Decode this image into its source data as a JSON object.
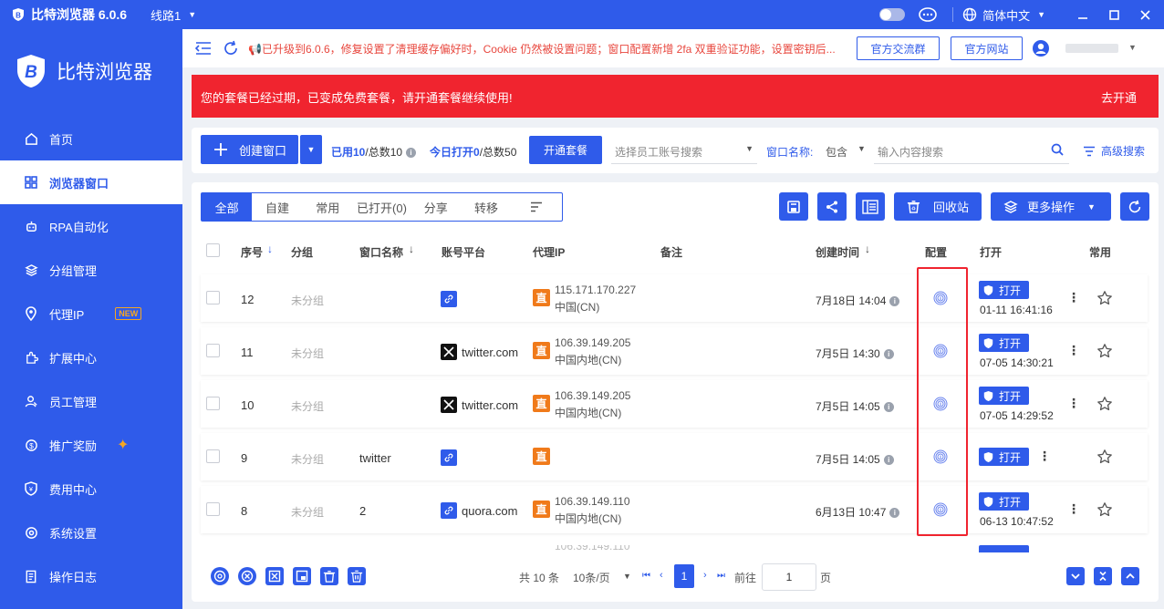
{
  "titlebar": {
    "app_title": "比特浏览器 6.0.6",
    "line": "线路1",
    "language": "简体中文"
  },
  "sidebar": {
    "brand": "比特浏览器",
    "items": [
      {
        "label": "首页",
        "icon": "home-icon"
      },
      {
        "label": "浏览器窗口",
        "icon": "grid-icon",
        "active": true
      },
      {
        "label": "RPA自动化",
        "icon": "rpa-icon"
      },
      {
        "label": "分组管理",
        "icon": "layers-icon"
      },
      {
        "label": "代理IP",
        "icon": "location-icon",
        "badge": "NEW"
      },
      {
        "label": "扩展中心",
        "icon": "extension-icon"
      },
      {
        "label": "员工管理",
        "icon": "staff-icon"
      },
      {
        "label": "推广奖励",
        "icon": "reward-icon"
      },
      {
        "label": "费用中心",
        "icon": "billing-icon"
      },
      {
        "label": "系统设置",
        "icon": "settings-icon"
      },
      {
        "label": "操作日志",
        "icon": "log-icon"
      }
    ]
  },
  "notice": {
    "text": "📢已升级到6.0.6，修复设置了清理缓存偏好时，Cookie 仍然被设置问题；窗口配置新增 2fa 双重验证功能，设置密钥后...",
    "btn_group": "官方交流群",
    "btn_site": "官方网站"
  },
  "expired": {
    "text": "您的套餐已经过期，已变成免费套餐，请开通套餐继续使用!",
    "action": "去开通"
  },
  "toolbar": {
    "create": "创建窗口",
    "used_label": "已用10",
    "used_total": "/总数10",
    "opened_label": "今日打开0",
    "opened_total": "/总数50",
    "plan_btn": "开通套餐",
    "staff_placeholder": "选择员工账号搜索",
    "filter_label": "窗口名称:",
    "filter_mode": "包含",
    "search_placeholder": "输入内容搜索",
    "advanced": "高级搜索"
  },
  "tabs": [
    "全部",
    "自建",
    "常用",
    "已打开(0)",
    "分享",
    "转移"
  ],
  "actions": {
    "recycle": "回收站",
    "more": "更多操作"
  },
  "table": {
    "headers": {
      "seq": "序号",
      "group": "分组",
      "name": "窗口名称",
      "platform": "账号平台",
      "proxy": "代理IP",
      "note": "备注",
      "created": "创建时间",
      "config": "配置",
      "open": "打开",
      "fav": "常用"
    },
    "open_label": "打开",
    "rows": [
      {
        "seq": "12",
        "group": "未分组",
        "name": "",
        "platform": "",
        "platform_icon": "link-icon",
        "ip": "115.171.170.227",
        "region": "中国(CN)",
        "created": "7月18日 14:04",
        "opened": "01-11 16:41:16"
      },
      {
        "seq": "11",
        "group": "未分组",
        "name": "",
        "platform": "twitter.com",
        "platform_icon": "x-logo-icon",
        "ip": "106.39.149.205",
        "region": "中国内地(CN)",
        "created": "7月5日 14:30",
        "opened": "07-05 14:30:21"
      },
      {
        "seq": "10",
        "group": "未分组",
        "name": "",
        "platform": "twitter.com",
        "platform_icon": "x-logo-icon",
        "ip": "106.39.149.205",
        "region": "中国内地(CN)",
        "created": "7月5日 14:05",
        "opened": "07-05 14:29:52"
      },
      {
        "seq": "9",
        "group": "未分组",
        "name": "twitter",
        "platform": "",
        "platform_icon": "link-icon",
        "ip": "",
        "region": "",
        "created": "7月5日 14:05",
        "opened": ""
      },
      {
        "seq": "8",
        "group": "未分组",
        "name": "2",
        "platform": "quora.com",
        "platform_icon": "link-icon",
        "ip": "106.39.149.110",
        "region": "中国内地(CN)",
        "created": "6月13日 10:47",
        "opened": "06-13 10:47:52"
      }
    ],
    "zhi": "直"
  },
  "pagination": {
    "total": "共 10 条",
    "page_size": "10条/页",
    "current": "1",
    "goto_label": "前往",
    "goto_value": "1",
    "page_suffix": "页"
  },
  "colors": {
    "primary": "#2f5bea",
    "alert": "#f0242f",
    "direct": "#f07a1a"
  }
}
